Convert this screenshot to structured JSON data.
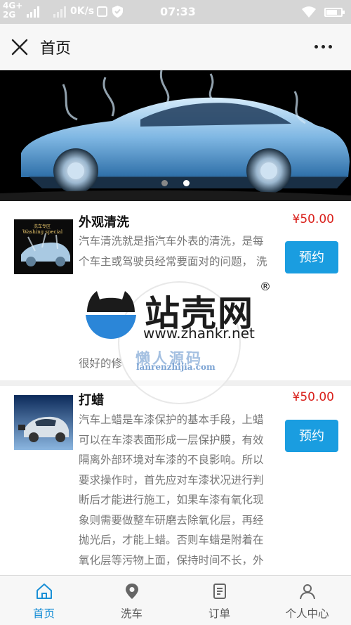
{
  "status_bar": {
    "network_top": "4G+",
    "network_bottom": "2G",
    "speed": "0K/s",
    "time": "07:33"
  },
  "nav": {
    "title": "首页",
    "close_icon": "close-icon",
    "more_icon": "more-dots-icon"
  },
  "banner": {
    "slide_count": 2,
    "active_slide": 1,
    "dot_active_color": "#ffffff",
    "dot_inactive_color": "#888888"
  },
  "services": [
    {
      "name": "外观清洗",
      "price": "¥50.00",
      "desc_lines": [
        "汽车清洗就是指汽车外表的清洗，是每",
        "个车主或驾驶员经常要面对的问题， 洗"
      ],
      "desc_tail": "很好的修",
      "thumb_text": "Washing special",
      "book_label": "预约"
    },
    {
      "name": "打蜡",
      "price": "¥50.00",
      "desc_lines": [
        "汽车上蜡是车漆保护的基本手段，上蜡",
        "可以在车漆表面形成一层保护膜，有效",
        "隔离外部环境对车漆的不良影响。所以",
        "要求操作时，首先应对车漆状况进行判",
        "断后才能进行施工，如果车漆有氧化现",
        "象则需要做整车研磨去除氧化层，再经",
        "抛光后，才能上蜡。否则车蜡是附着在",
        "氧化层等污物上面，保持时间不长，外"
      ],
      "book_label": "预约"
    }
  ],
  "watermark": {
    "title": "站壳网",
    "registered": "®",
    "url": "www.zhankr.net",
    "secondary_title": "懒人源码",
    "secondary_url": "lanrenzhijia.com"
  },
  "tabs": [
    {
      "label": "首页",
      "icon": "home-icon",
      "active": true
    },
    {
      "label": "洗车",
      "icon": "location-pin-icon",
      "active": false
    },
    {
      "label": "订单",
      "icon": "order-list-icon",
      "active": false
    },
    {
      "label": "个人中心",
      "icon": "user-icon",
      "active": false
    }
  ],
  "colors": {
    "accent": "#1a9de0",
    "price": "#d9201b",
    "tab_active": "#1a8fd6"
  }
}
